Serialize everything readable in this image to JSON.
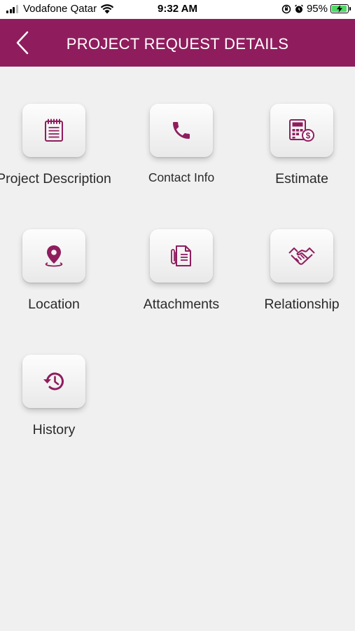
{
  "status_bar": {
    "carrier": "Vodafone Qatar",
    "time": "9:32 AM",
    "battery": "95%",
    "battery_level": 0.95
  },
  "header": {
    "title": "PROJECT REQUEST DETAILS"
  },
  "accent_color": "#8f1d5d",
  "tiles": [
    {
      "label": "Project Description",
      "icon": "notepad-icon"
    },
    {
      "label": "Contact Info",
      "icon": "phone-icon"
    },
    {
      "label": "Estimate",
      "icon": "calculator-icon"
    },
    {
      "label": "Location",
      "icon": "location-pin-icon"
    },
    {
      "label": "Attachments",
      "icon": "attachment-icon"
    },
    {
      "label": "Relationship",
      "icon": "handshake-icon"
    },
    {
      "label": "History",
      "icon": "history-icon"
    }
  ]
}
